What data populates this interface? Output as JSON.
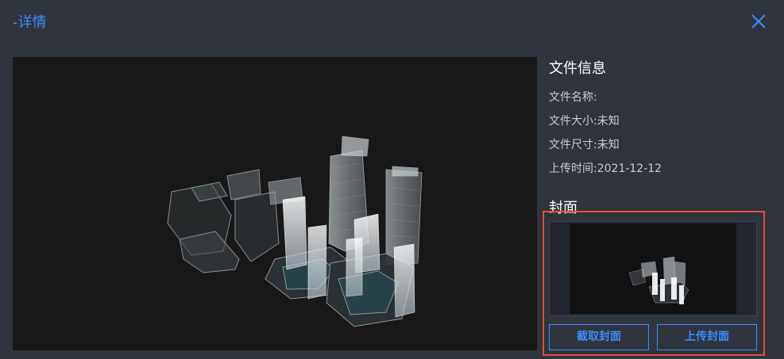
{
  "dialog": {
    "title": "-详情",
    "close_icon": "close-icon"
  },
  "file_info": {
    "heading": "文件信息",
    "rows": [
      "文件名称:",
      "文件大小:未知",
      "文件尺寸:未知",
      "上传时间:2021-12-12"
    ]
  },
  "cover": {
    "heading": "封面",
    "capture_label": "截取封面",
    "upload_label": "上传封面"
  },
  "colors": {
    "accent": "#3e8cff",
    "highlight": "#e2503a",
    "background": "#2f343d",
    "viewer": "#181818"
  }
}
